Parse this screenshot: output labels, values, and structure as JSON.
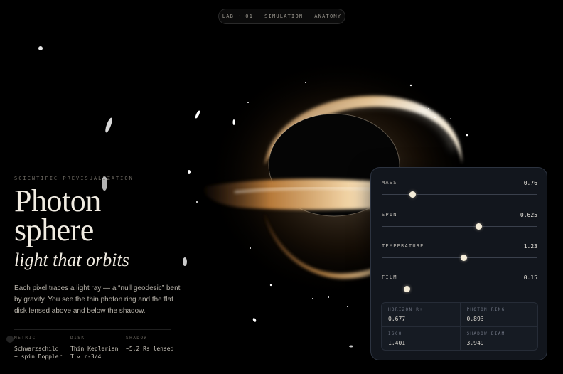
{
  "nav": {
    "items": [
      "LAB · 01",
      "SIMULATION",
      "ANATOMY"
    ]
  },
  "hero": {
    "eyebrow": "SCIENTIFIC PREVISUALIZATION",
    "title_line1": "Photon",
    "title_line2": "sphere",
    "subtitle": "light that orbits",
    "description": "Each pixel traces a light ray — a “null geodesic” bent by gravity. You see the thin photon ring and the flat disk lensed above and below the shadow."
  },
  "meta": [
    {
      "key": "METRIC",
      "line1": "Schwarzschild",
      "line2": "+ spin Doppler"
    },
    {
      "key": "DISK",
      "line1": "Thin Keplerian",
      "line2": "T ∝ r-3/4"
    },
    {
      "key": "SHADOW",
      "line1": "~5.2 Rs lensed",
      "line2": ""
    }
  ],
  "controls": {
    "sliders": [
      {
        "label": "MASS",
        "value": "0.76",
        "fraction": 0.2
      },
      {
        "label": "SPIN",
        "value": "0.625",
        "fraction": 0.625
      },
      {
        "label": "TEMPERATURE",
        "value": "1.23",
        "fraction": 0.53
      },
      {
        "label": "FILM",
        "value": "0.15",
        "fraction": 0.165
      }
    ],
    "readouts": [
      {
        "key": "HORIZON R+",
        "value": "0.677"
      },
      {
        "key": "PHOTON RING",
        "value": "0.893"
      },
      {
        "key": "ISCO",
        "value": "1.401"
      },
      {
        "key": "SHADOW DIAM",
        "value": "3.949"
      }
    ]
  },
  "colors": {
    "background": "#000000",
    "disk_warm": "#c98a3e",
    "disk_hot": "#fff3dc",
    "panel": "#12161d"
  }
}
